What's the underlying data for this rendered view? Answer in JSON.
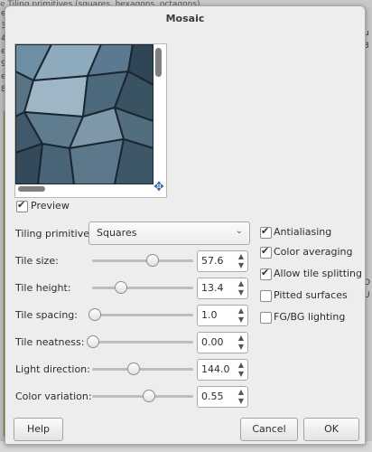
{
  "background": {
    "top_text": "e Tiling primitives (squares, hexagons, octagons), ...",
    "left_letters": [
      "e",
      "3",
      "4",
      "e",
      "9",
      "e",
      "8"
    ],
    "right_letters": [
      "u",
      "8",
      "O",
      "U"
    ]
  },
  "dialog": {
    "title": "Mosaic",
    "preview_label": "Preview",
    "preview_checked": true,
    "tiling_label": "Tiling primitives:",
    "tiling_value": "Squares",
    "sliders": [
      {
        "label": "Tile size:",
        "value": "57.6",
        "fraction": 0.59
      },
      {
        "label": "Tile height:",
        "value": "13.4",
        "fraction": 0.28
      },
      {
        "label": "Tile spacing:",
        "value": "1.0",
        "fraction": 0.02
      },
      {
        "label": "Tile neatness:",
        "value": "0.00",
        "fraction": 0.0
      },
      {
        "label": "Light direction:",
        "value": "144.0",
        "fraction": 0.4
      },
      {
        "label": "Color variation:",
        "value": "0.55",
        "fraction": 0.55
      }
    ],
    "options": [
      {
        "label": "Antialiasing",
        "checked": true
      },
      {
        "label": "Color averaging",
        "checked": true
      },
      {
        "label": "Allow tile splitting",
        "checked": true
      },
      {
        "label": "Pitted surfaces",
        "checked": false
      },
      {
        "label": "FG/BG lighting",
        "checked": false
      }
    ],
    "buttons": {
      "help": "Help",
      "cancel": "Cancel",
      "ok": "OK"
    }
  }
}
